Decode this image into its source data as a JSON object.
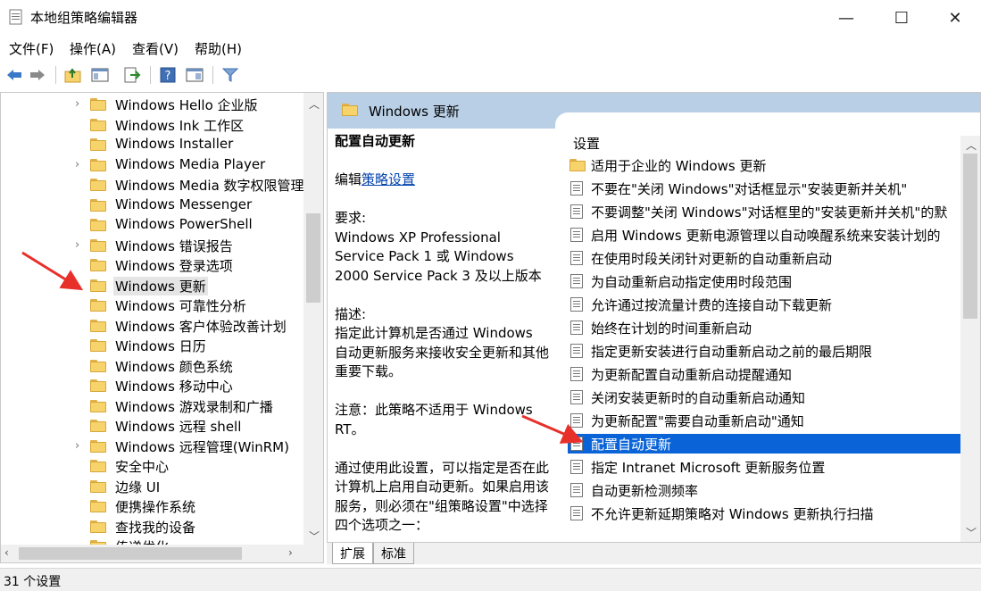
{
  "window": {
    "title": "本地组策略编辑器",
    "controls": {
      "minimize": "—",
      "maximize": "☐",
      "close": "✕"
    }
  },
  "menu": [
    "文件(F)",
    "操作(A)",
    "查看(V)",
    "帮助(H)"
  ],
  "toolbar_icons": [
    "back-icon",
    "forward-icon",
    "folder-up-icon",
    "show-hide-tree-icon",
    "export-icon",
    "help-icon",
    "properties-icon",
    "filter-icon"
  ],
  "tree": {
    "items": [
      {
        "label": "Windows Hello 企业版",
        "expandable": true
      },
      {
        "label": "Windows Ink 工作区",
        "expandable": false
      },
      {
        "label": "Windows Installer",
        "expandable": false
      },
      {
        "label": "Windows Media Player",
        "expandable": true
      },
      {
        "label": "Windows Media 数字权限管理",
        "expandable": false
      },
      {
        "label": "Windows Messenger",
        "expandable": false
      },
      {
        "label": "Windows PowerShell",
        "expandable": false
      },
      {
        "label": "Windows 错误报告",
        "expandable": true
      },
      {
        "label": "Windows 登录选项",
        "expandable": false
      },
      {
        "label": "Windows 更新",
        "expandable": false,
        "selected": true
      },
      {
        "label": "Windows 可靠性分析",
        "expandable": false
      },
      {
        "label": "Windows 客户体验改善计划",
        "expandable": false
      },
      {
        "label": "Windows 日历",
        "expandable": false
      },
      {
        "label": "Windows 颜色系统",
        "expandable": false
      },
      {
        "label": "Windows 移动中心",
        "expandable": false
      },
      {
        "label": "Windows 游戏录制和广播",
        "expandable": false
      },
      {
        "label": "Windows 远程 shell",
        "expandable": false
      },
      {
        "label": "Windows 远程管理(WinRM)",
        "expandable": true
      },
      {
        "label": "安全中心",
        "expandable": false
      },
      {
        "label": "边缘 UI",
        "expandable": false
      },
      {
        "label": "便携操作系统",
        "expandable": false
      },
      {
        "label": "查找我的设备",
        "expandable": false
      },
      {
        "label": "传递优化",
        "expandable": false
      }
    ]
  },
  "details": {
    "header": "Windows 更新",
    "policy_title": "配置自动更新",
    "edit_prefix": "编辑",
    "edit_link": "策略设置",
    "requirement_label": "要求:",
    "requirement_text": "Windows XP Professional Service Pack 1 或 Windows 2000 Service Pack 3 及以上版本",
    "description_label": "描述:",
    "description_text": "指定此计算机是否通过 Windows 自动更新服务来接收安全更新和其他重要下载。",
    "note_text": "注意：此策略不适用于 Windows RT。",
    "usage_text": "通过使用此设置，可以指定是否在此计算机上启用自动更新。如果启用该服务，则必须在\"组策略设置\"中选择四个选项之一："
  },
  "settings": {
    "header": "设置",
    "items": [
      {
        "label": "适用于企业的 Windows 更新",
        "type": "folder"
      },
      {
        "label": "不要在\"关闭 Windows\"对话框显示\"安装更新并关机\"",
        "type": "policy"
      },
      {
        "label": "不要调整\"关闭 Windows\"对话框里的\"安装更新并关机\"的默",
        "type": "policy"
      },
      {
        "label": "启用 Windows 更新电源管理以自动唤醒系统来安装计划的",
        "type": "policy"
      },
      {
        "label": "在使用时段关闭针对更新的自动重新启动",
        "type": "policy"
      },
      {
        "label": "为自动重新启动指定使用时段范围",
        "type": "policy"
      },
      {
        "label": "允许通过按流量计费的连接自动下载更新",
        "type": "policy"
      },
      {
        "label": "始终在计划的时间重新启动",
        "type": "policy"
      },
      {
        "label": "指定更新安装进行自动重新启动之前的最后期限",
        "type": "policy"
      },
      {
        "label": "为更新配置自动重新启动提醒通知",
        "type": "policy"
      },
      {
        "label": "关闭安装更新时的自动重新启动通知",
        "type": "policy"
      },
      {
        "label": "为更新配置\"需要自动重新启动\"通知",
        "type": "policy"
      },
      {
        "label": "配置自动更新",
        "type": "policy",
        "selected": true
      },
      {
        "label": "指定 Intranet Microsoft 更新服务位置",
        "type": "policy"
      },
      {
        "label": "自动更新检测频率",
        "type": "policy"
      },
      {
        "label": "不允许更新延期策略对 Windows 更新执行扫描",
        "type": "policy"
      }
    ]
  },
  "tabs": [
    "扩展",
    "标准"
  ],
  "status": "31 个设置",
  "colors": {
    "selection": "#0a64d8",
    "header_band": "#b9cfe6",
    "arrow": "#e8302a"
  }
}
